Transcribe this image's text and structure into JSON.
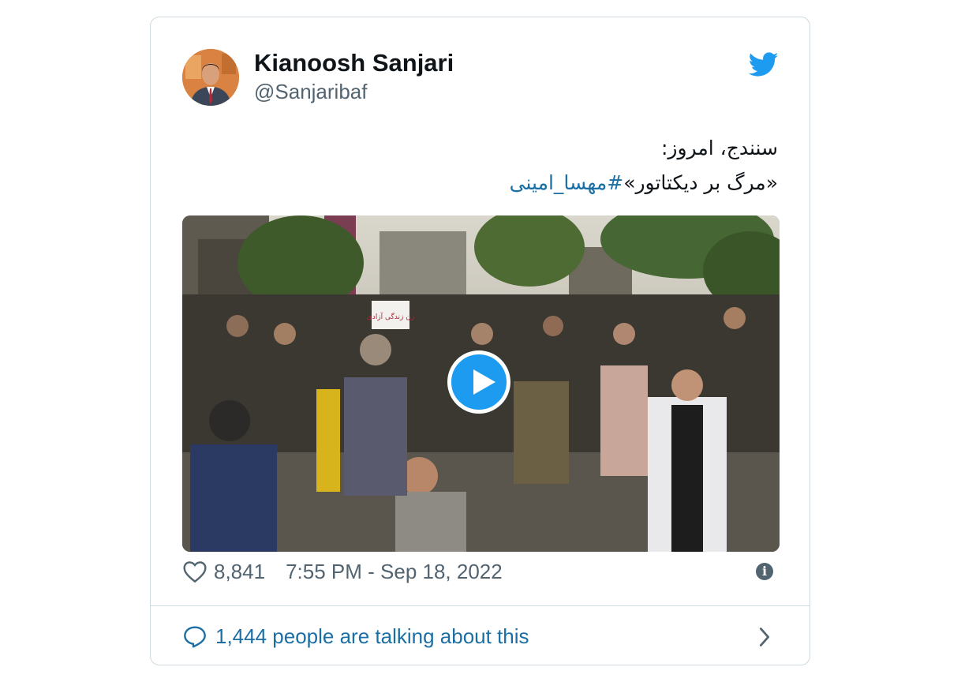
{
  "author": {
    "name": "Kianoosh Sanjari",
    "handle": "@Sanjaribaf"
  },
  "tweet": {
    "line1": "سنندج، امروز:",
    "line2_text": "«مرگ بر دیکتاتور»",
    "hashtag": "#مهسا_امینی"
  },
  "media": {
    "type": "video",
    "sign_text": "زن زندگی آزادی"
  },
  "meta": {
    "likes": "8,841",
    "timestamp": "7:55 PM - Sep 18, 2022"
  },
  "footer": {
    "talking": "1,444 people are talking about this"
  },
  "colors": {
    "brand_blue": "#1d9bf0",
    "link_blue": "#1b6fa5",
    "secondary_text": "#536471",
    "border": "#cfd9de"
  },
  "icons": {
    "logo": "twitter-bird-icon",
    "like": "heart-icon",
    "info": "info-icon",
    "replies": "speech-bubble-icon",
    "more": "chevron-right-icon",
    "play": "play-icon"
  }
}
